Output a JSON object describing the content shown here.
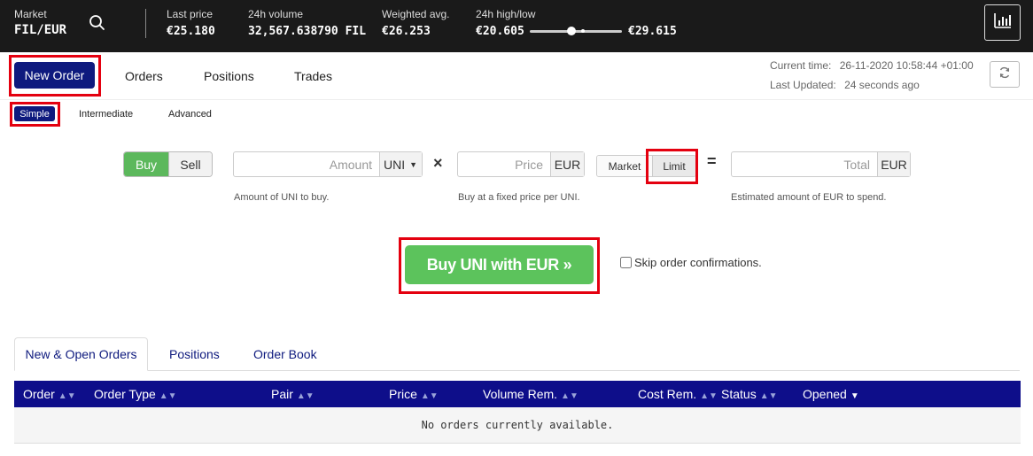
{
  "topbar": {
    "market_label": "Market",
    "market_pair": "FIL/EUR",
    "stats": [
      {
        "label": "Last price",
        "value": "€25.180"
      },
      {
        "label": "24h volume",
        "value": "32,567.638790 FIL"
      },
      {
        "label": "Weighted avg.",
        "value": "€26.253"
      },
      {
        "label": "24h high/low",
        "low": "€20.605",
        "high": "€29.615",
        "position_pct": 45
      }
    ]
  },
  "nav": {
    "new_order": "New Order",
    "tabs": [
      "Orders",
      "Positions",
      "Trades"
    ],
    "current_time_label": "Current time:",
    "current_time_value": "26-11-2020 10:58:44 +01:00",
    "last_updated_label": "Last Updated:",
    "last_updated_value": "24 seconds ago"
  },
  "subtabs": {
    "simple": "Simple",
    "intermediate": "Intermediate",
    "advanced": "Advanced"
  },
  "form": {
    "buy": "Buy",
    "sell": "Sell",
    "amount_placeholder": "Amount",
    "amount_currency": "UNI",
    "amount_help": "Amount of UNI to buy.",
    "times": "×",
    "price_placeholder": "Price",
    "price_currency": "EUR",
    "price_help": "Buy at a fixed price per UNI.",
    "market": "Market",
    "limit": "Limit",
    "equals": "=",
    "total_placeholder": "Total",
    "total_currency": "EUR",
    "total_help": "Estimated amount of EUR to spend.",
    "submit": "Buy UNI with EUR »",
    "skip_confirm": "Skip order confirmations."
  },
  "bottom_tabs": {
    "active": "New & Open Orders",
    "positions": "Positions",
    "order_book": "Order Book"
  },
  "table": {
    "columns": [
      "Order",
      "Order Type",
      "Pair",
      "Price",
      "Volume Rem.",
      "Cost Rem.",
      "Status",
      "Opened"
    ],
    "empty_message": "No orders currently available."
  },
  "colors": {
    "topbar_bg": "#1a1a1a",
    "primary": "#0e1a7e",
    "buy_green": "#5cb85c",
    "highlight_red": "#e4000f",
    "table_header": "#0e0e8a"
  }
}
